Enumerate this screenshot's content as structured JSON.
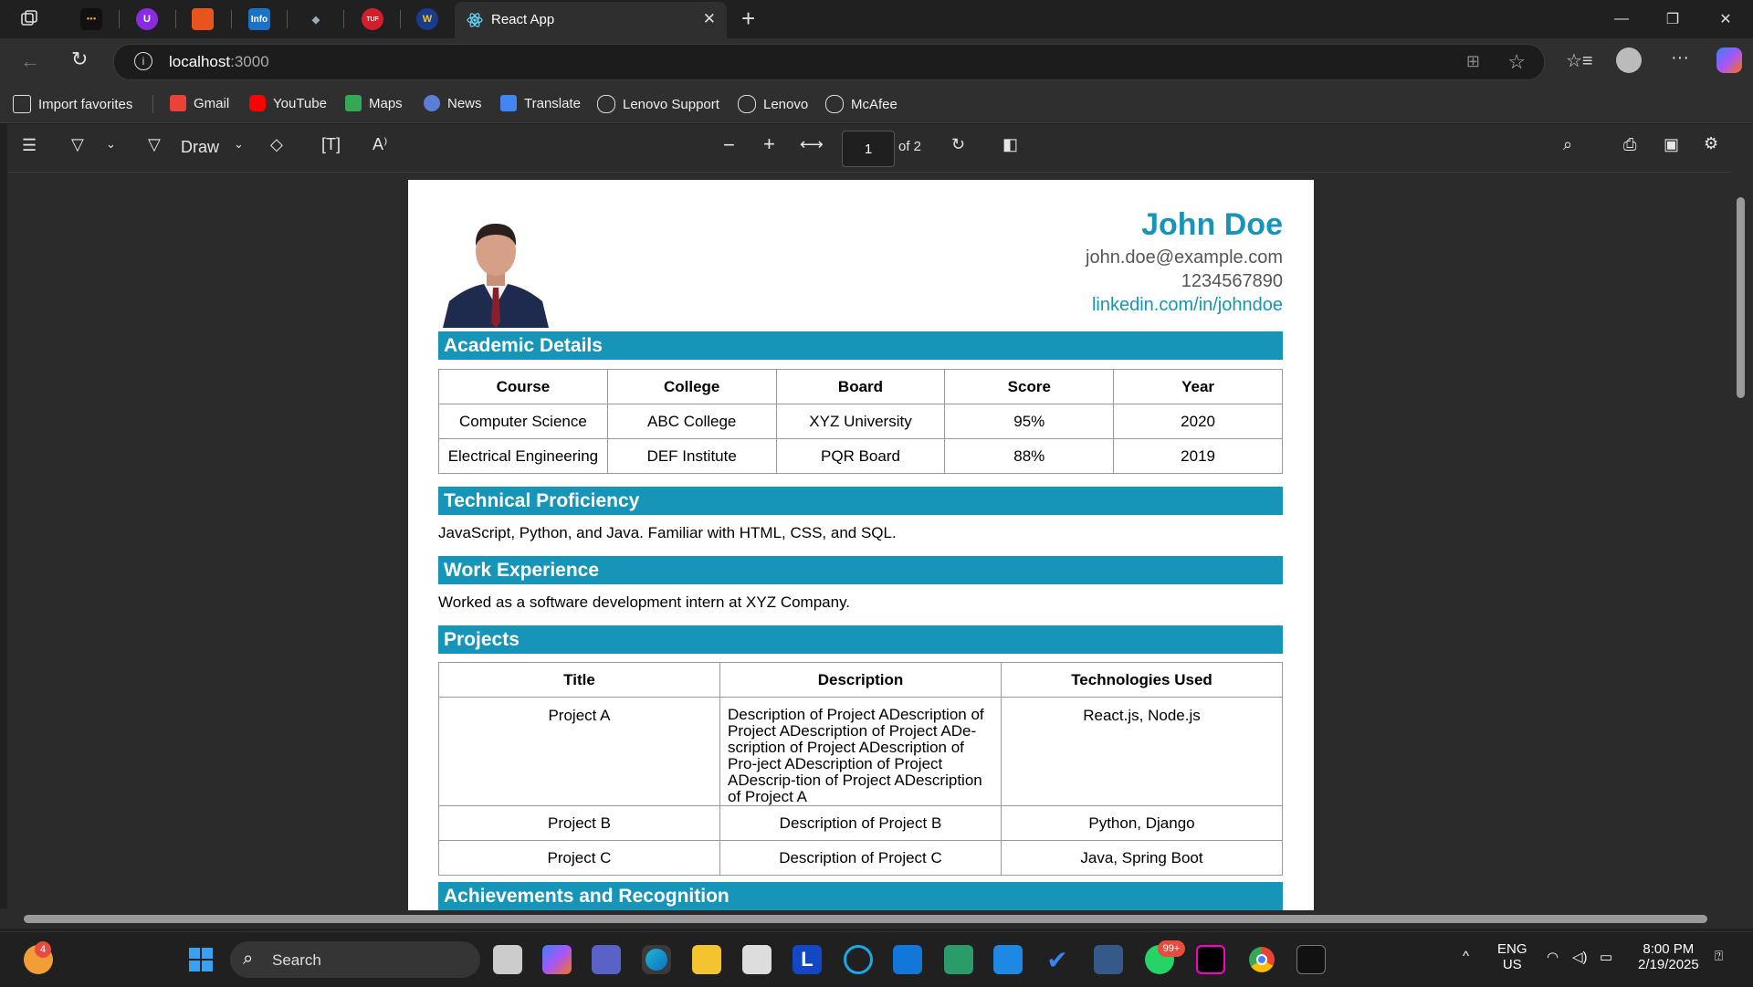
{
  "browser": {
    "active_tab_title": "React App",
    "url_host": "localhost",
    "url_port": ":3000",
    "bookmarks": [
      "Import favorites",
      "Gmail",
      "YouTube",
      "Maps",
      "News",
      "Translate",
      "Lenovo Support",
      "Lenovo",
      "McAfee"
    ]
  },
  "pdf_toolbar": {
    "draw_label": "Draw",
    "page_current": "1",
    "page_total": "of 2"
  },
  "resume": {
    "name": "John Doe",
    "email": "john.doe@example.com",
    "phone": "1234567890",
    "linkedin": "linkedin.com/in/johndoe",
    "academic_title": "Academic Details",
    "academic_headers": [
      "Course",
      "College",
      "Board",
      "Score",
      "Year"
    ],
    "academic_rows": [
      [
        "Computer Science",
        "ABC College",
        "XYZ University",
        "95%",
        "2020"
      ],
      [
        "Electrical Engineering",
        "DEF Institute",
        "PQR Board",
        "88%",
        "2019"
      ]
    ],
    "tech_title": "Technical Proficiency",
    "tech_text": "JavaScript, Python, and Java. Familiar with HTML, CSS, and SQL.",
    "work_title": "Work Experience",
    "work_text": "Worked as a software development intern at XYZ Company.",
    "projects_title": "Projects",
    "projects_headers": [
      "Title",
      "Description",
      "Technologies Used"
    ],
    "projects_rows": [
      [
        "Project A",
        "Description of Project ADescription of Project ADescription of Project ADe-scription of Project ADescription of Pro-ject ADescription of Project ADescrip-tion of Project ADescription of Project A",
        "React.js, Node.js"
      ],
      [
        "Project B",
        "Description of Project B",
        "Python, Django"
      ],
      [
        "Project C",
        "Description of Project C",
        "Java, Spring Boot"
      ]
    ],
    "achievements_title": "Achievements and Recognition"
  },
  "taskbar": {
    "weather_badge": "4",
    "search_label": "Search",
    "whatsapp_badge": "99+",
    "lang": "ENG",
    "region": "US",
    "time": "8:00 PM",
    "date": "2/19/2025"
  },
  "colors": {
    "accent": "#1795b8",
    "browser_bg": "#202020",
    "toolbar_bg": "#2f2f2f"
  }
}
